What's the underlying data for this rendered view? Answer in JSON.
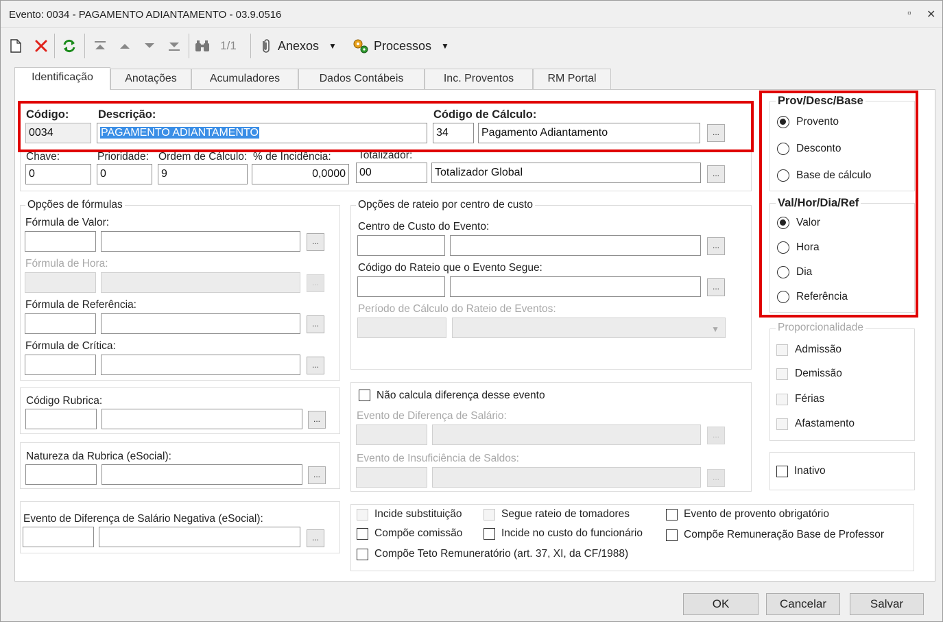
{
  "window": {
    "title": "Evento: 0034 - PAGAMENTO ADIANTAMENTO - 03.9.0516",
    "restore_glyph": "▫",
    "close_glyph": "✕"
  },
  "toolbar": {
    "new_icon": "new-doc-icon",
    "delete_icon": "delete-icon",
    "refresh_icon": "refresh-icon",
    "first_icon": "first-record-icon",
    "prev_icon": "previous-record-icon",
    "next_icon": "next-record-icon",
    "last_icon": "last-record-icon",
    "search_icon": "binoculars-icon",
    "record_counter": "1/1",
    "attachments_label": "Anexos",
    "processes_label": "Processos"
  },
  "tabs": [
    {
      "label": "Identificação",
      "active": true
    },
    {
      "label": "Anotações"
    },
    {
      "label": "Acumuladores"
    },
    {
      "label": "Dados Contábeis"
    },
    {
      "label": "Inc. Proventos"
    },
    {
      "label": "RM Portal"
    }
  ],
  "identification": {
    "codigo_label": "Código:",
    "codigo_value": "0034",
    "descricao_label": "Descrição:",
    "descricao_value": "PAGAMENTO ADIANTAMENTO",
    "codigo_calculo_label": "Código de Cálculo:",
    "codigo_calculo_value": "34",
    "codigo_calculo_desc": "Pagamento Adiantamento",
    "chave_label": "Chave:",
    "chave_value": "0",
    "prioridade_label": "Prioridade:",
    "prioridade_value": "0",
    "ordem_label": "Ordem de Cálculo:",
    "ordem_value": "9",
    "incidencia_label": "% de Incidência:",
    "incidencia_value": "0,0000",
    "totalizador_label": "Totalizador:",
    "totalizador_code": "00",
    "totalizador_desc": "Totalizador Global",
    "lookup_label": "..."
  },
  "formulas": {
    "group_label": "Opções de fórmulas",
    "valor_label": "Fórmula de Valor:",
    "hora_label": "Fórmula de Hora:",
    "referencia_label": "Fórmula de Referência:",
    "critica_label": "Fórmula de Crítica:"
  },
  "rubrica": {
    "codigo_label": "Código Rubrica:",
    "natureza_label": "Natureza da Rubrica (eSocial):",
    "diferenca_negativa_label": "Evento de Diferença de Salário Negativa (eSocial):"
  },
  "rateio": {
    "group_label": "Opções de rateio por centro de custo",
    "centro_custo_label": "Centro de Custo do Evento:",
    "codigo_rateio_label": "Código do Rateio que o Evento Segue:",
    "periodo_label": "Período de Cálculo do Rateio de Eventos:"
  },
  "diferenca": {
    "nao_calcula_label": "Não calcula diferença desse evento",
    "evento_diferenca_label": "Evento de Diferença de Salário:",
    "evento_insuficiencia_label": "Evento de Insuficiência de Saldos:"
  },
  "options": {
    "incide_substituicao": "Incide substituição",
    "segue_rateio": "Segue rateio de tomadores",
    "evento_obrigatorio": "Evento de provento obrigatório",
    "compoe_comissao": "Compõe comissão",
    "incide_custo": "Incide no custo do funcionário",
    "compoe_remuneracao": "Compõe Remuneração Base de Professor",
    "compoe_teto": "Compõe Teto Remuneratório (art. 37, XI, da CF/1988)"
  },
  "prov_desc_base": {
    "label": "Prov/Desc/Base",
    "options": [
      "Provento",
      "Desconto",
      "Base de cálculo"
    ],
    "selected": "Provento"
  },
  "val_hor_dia_ref": {
    "label": "Val/Hor/Dia/Ref",
    "options": [
      "Valor",
      "Hora",
      "Dia",
      "Referência"
    ],
    "selected": "Valor"
  },
  "proporcionalidade": {
    "label": "Proporcionalidade",
    "options": [
      "Admissão",
      "Demissão",
      "Férias",
      "Afastamento"
    ]
  },
  "inativo_label": "Inativo",
  "buttons": {
    "ok": "OK",
    "cancel": "Cancelar",
    "save": "Salvar"
  },
  "colors": {
    "highlight_box": "#e00000",
    "selection": "#3a8ee6"
  }
}
